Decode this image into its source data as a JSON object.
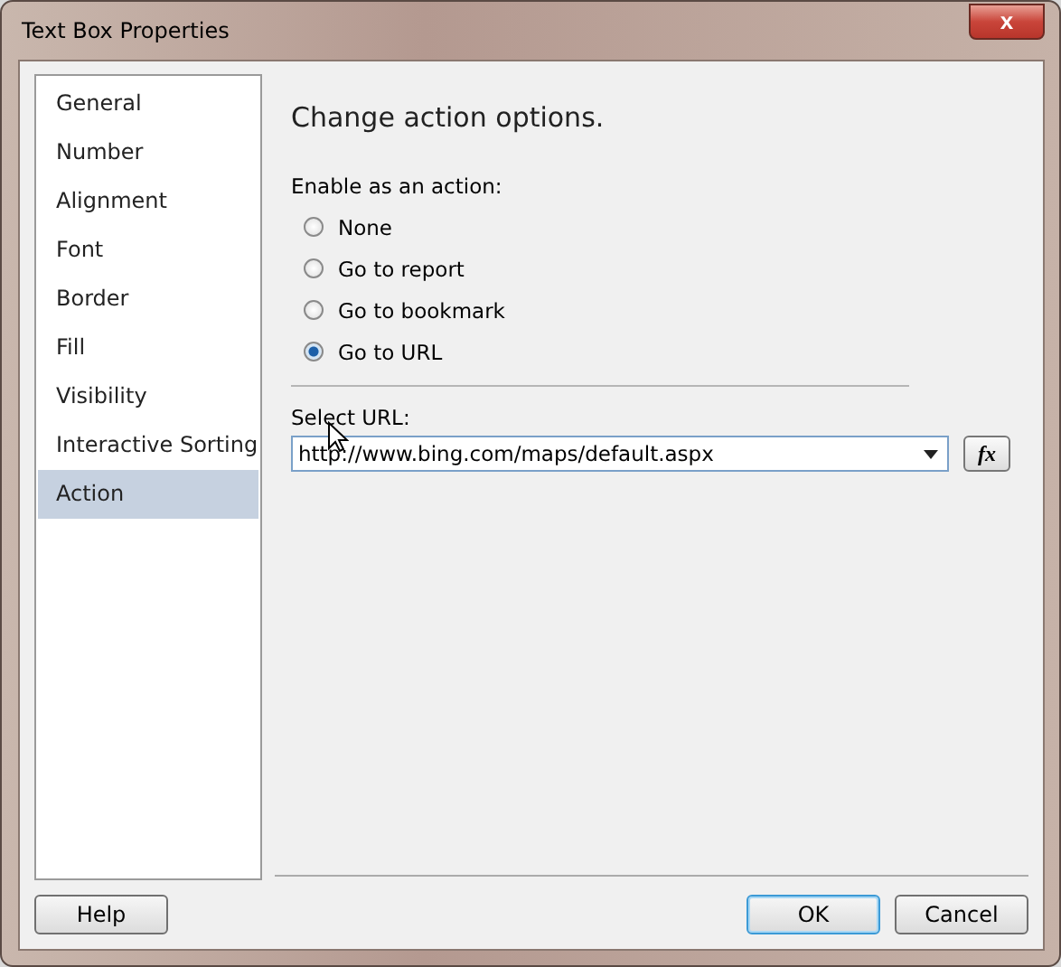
{
  "window": {
    "title": "Text Box Properties",
    "close": "x"
  },
  "sidebar": {
    "items": [
      {
        "label": "General",
        "selected": false
      },
      {
        "label": "Number",
        "selected": false
      },
      {
        "label": "Alignment",
        "selected": false
      },
      {
        "label": "Font",
        "selected": false
      },
      {
        "label": "Border",
        "selected": false
      },
      {
        "label": "Fill",
        "selected": false
      },
      {
        "label": "Visibility",
        "selected": false
      },
      {
        "label": "Interactive Sorting",
        "selected": false
      },
      {
        "label": "Action",
        "selected": true
      }
    ]
  },
  "heading": "Change action options.",
  "action_group": {
    "label": "Enable as an action:",
    "options": [
      {
        "label": "None",
        "selected": false
      },
      {
        "label": "Go to report",
        "selected": false
      },
      {
        "label": "Go to bookmark",
        "selected": false
      },
      {
        "label": "Go to URL",
        "selected": true
      }
    ]
  },
  "url_field": {
    "label": "Select URL:",
    "value": "http://www.bing.com/maps/default.aspx",
    "expression_button": "fx"
  },
  "buttons": {
    "help": "Help",
    "ok": "OK",
    "cancel": "Cancel"
  }
}
